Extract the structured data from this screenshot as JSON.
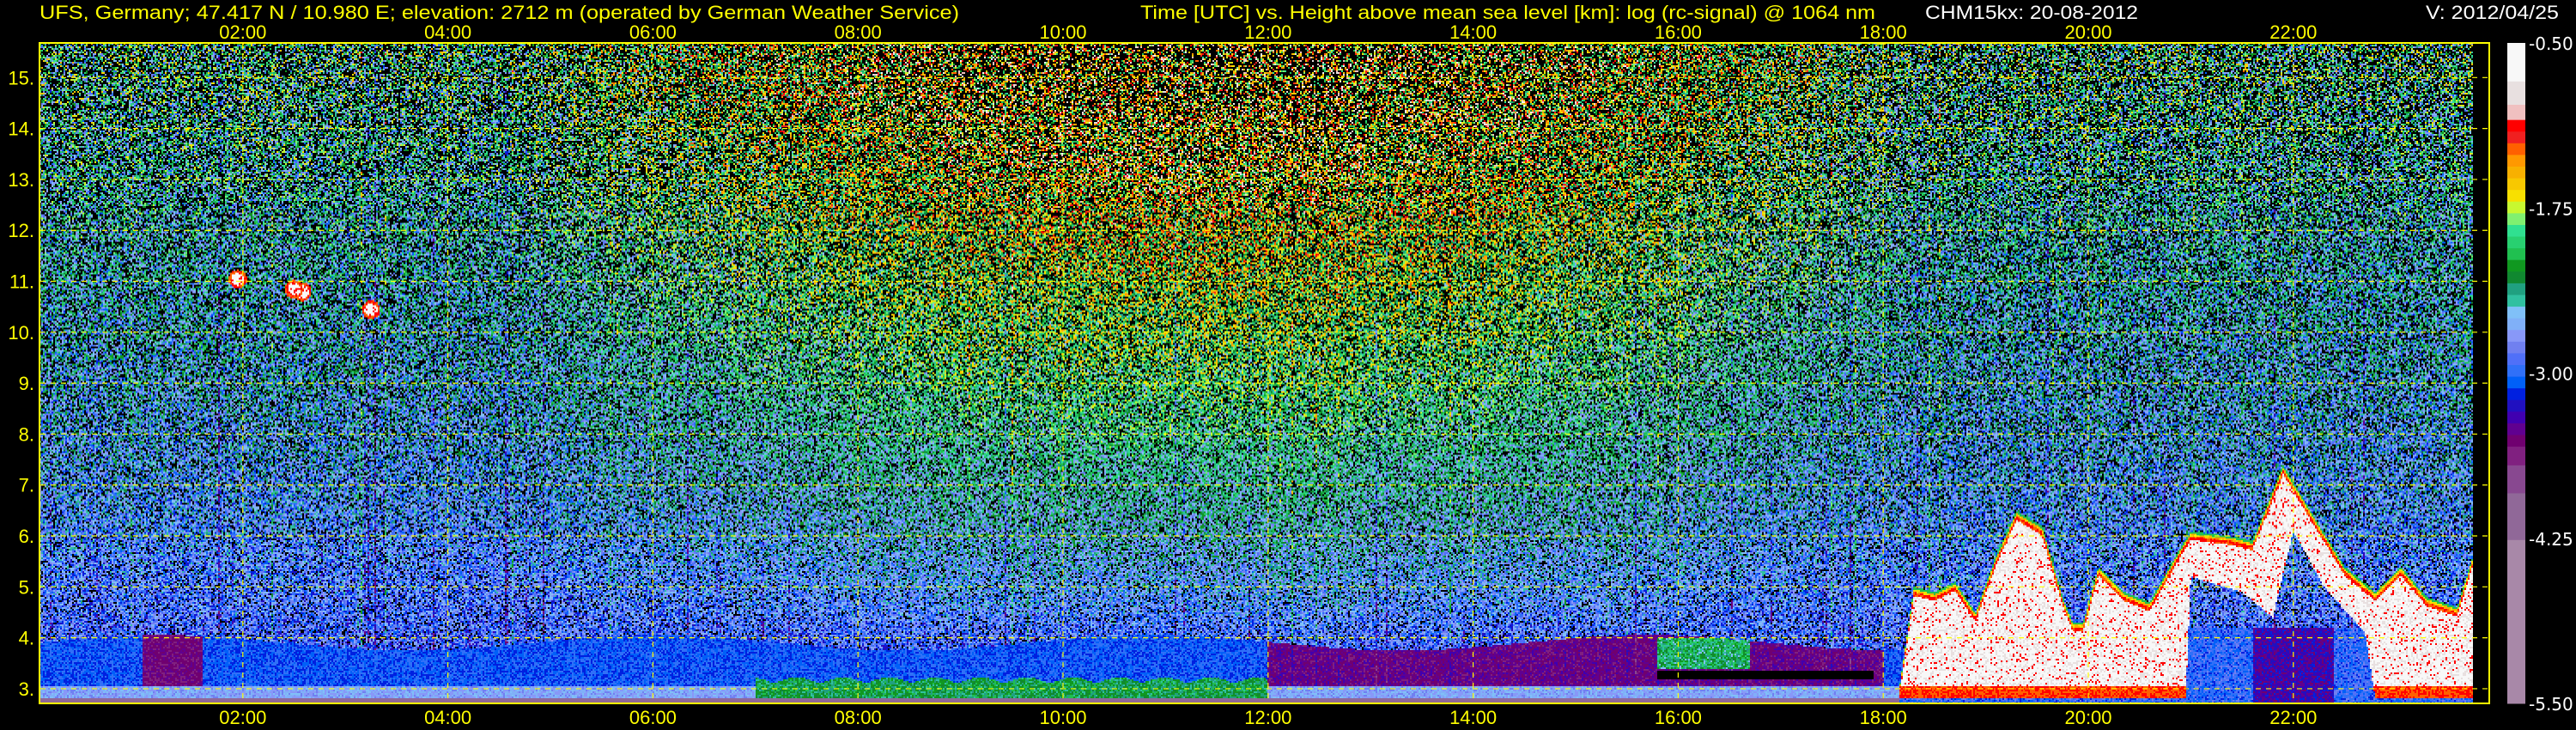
{
  "header": {
    "station": "UFS, Germany; 47.417 N / 10.980 E; elevation: 2712 m  (operated by German Weather Service)",
    "plot_title": "Time [UTC] vs. Height above mean sea level [km]: log (rc-signal) @ 1064 nm",
    "instrument_date": "CHM15kx: 20-08-2012",
    "version": "V: 2012/04/25"
  },
  "colors": {
    "axis_text": "#ffff00",
    "grid": "#ffff00",
    "info_text": "#ffffff",
    "background": "#000000"
  },
  "chart_data": {
    "type": "heatmap",
    "title": "Time [UTC] vs. Height above mean sea level [km]: log (rc-signal) @ 1064 nm",
    "xlabel": "Time [UTC]",
    "ylabel": "Height above mean sea level [km]",
    "xlim_hours": [
      0,
      24
    ],
    "ylim_km": [
      2.712,
      15.68
    ],
    "x_ticks": [
      "02:00",
      "04:00",
      "06:00",
      "08:00",
      "10:00",
      "12:00",
      "14:00",
      "16:00",
      "18:00",
      "20:00",
      "22:00"
    ],
    "x_tick_values": [
      2,
      4,
      6,
      8,
      10,
      12,
      14,
      16,
      18,
      20,
      22
    ],
    "y_ticks": [
      "3.",
      "4.",
      "5.",
      "6.",
      "7.",
      "8.",
      "9.",
      "10.",
      "11.",
      "12.",
      "13.",
      "14.",
      "15."
    ],
    "y_tick_values": [
      3,
      4,
      5,
      6,
      7,
      8,
      9,
      10,
      11,
      12,
      13,
      14,
      15
    ],
    "grid": true,
    "colorbar": {
      "range": [
        -5.5,
        -0.5
      ],
      "labels": [
        "-0.50",
        "-1.75",
        "-3.00",
        "-4.25",
        "-5.50"
      ],
      "label_values": [
        -0.5,
        -1.75,
        -3.0,
        -4.25,
        -5.5
      ],
      "colors": [
        "#f8f8f8",
        "#e8e0e0",
        "#f0c0c0",
        "#ff0000",
        "#f02020",
        "#ff6000",
        "#ff9800",
        "#f8b000",
        "#f8c800",
        "#f8e000",
        "#c8f830",
        "#80f070",
        "#30e090",
        "#28d070",
        "#20c050",
        "#109820",
        "#108830",
        "#20a080",
        "#30c0a0",
        "#80c0f8",
        "#80b0f8",
        "#8898f8",
        "#7080f0",
        "#5070f8",
        "#3070f8",
        "#0060f8",
        "#0020e0",
        "#2010c0",
        "#4000b0",
        "#600090",
        "#700070",
        "#802080",
        "#884890",
        "#906898",
        "#a888a8"
      ]
    }
  }
}
